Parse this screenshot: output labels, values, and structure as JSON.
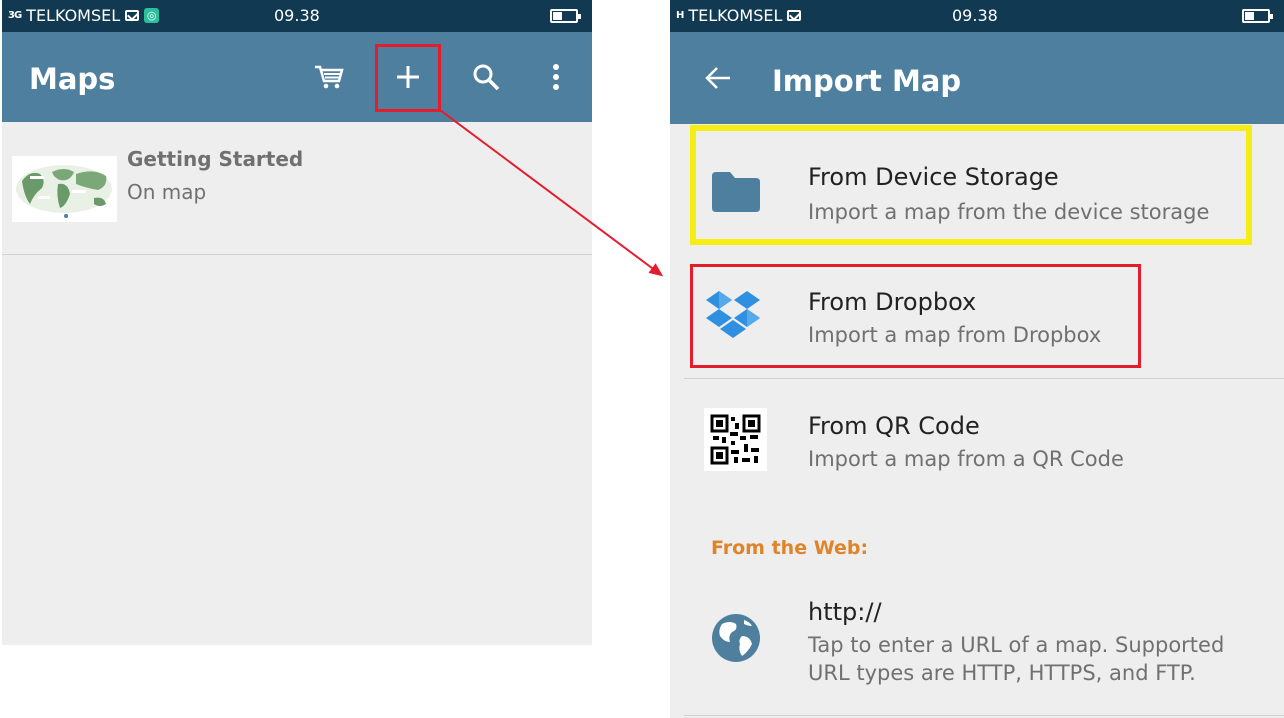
{
  "left_screen": {
    "status_bar": {
      "signal": "3G",
      "carrier": "TELKOMSEL",
      "time": "09.38"
    },
    "toolbar": {
      "title": "Maps",
      "icons": [
        "cart-icon",
        "plus-icon",
        "search-icon",
        "more-vert-icon"
      ]
    },
    "maps": [
      {
        "title": "Getting Started",
        "subtitle": "On map"
      }
    ]
  },
  "right_screen": {
    "status_bar": {
      "signal": "H",
      "carrier": "TELKOMSEL",
      "time": "09.38"
    },
    "toolbar": {
      "title": "Import Map"
    },
    "options": [
      {
        "title": "From Device Storage",
        "subtitle": "Import a map from the device storage",
        "icon": "folder-icon"
      },
      {
        "title": "From Dropbox",
        "subtitle": "Import a map from Dropbox",
        "icon": "dropbox-icon"
      },
      {
        "title": "From QR Code",
        "subtitle": "Import a map from a QR Code",
        "icon": "qr-code-icon"
      }
    ],
    "web_section": {
      "header": "From the Web:",
      "title": "http://",
      "subtitle_line1": "Tap to enter a URL of a map. Supported",
      "subtitle_line2": "URL types are HTTP, HTTPS, and FTP.",
      "icon": "globe-icon"
    }
  },
  "colors": {
    "toolbar": "#4e7f9e",
    "status_bar": "#113a52",
    "background": "#eeeeee",
    "section_header": "#e0842a",
    "highlight_red": "#e41d2d",
    "highlight_yellow": "#f5ee14",
    "folder_icon": "#4e7f9e"
  }
}
